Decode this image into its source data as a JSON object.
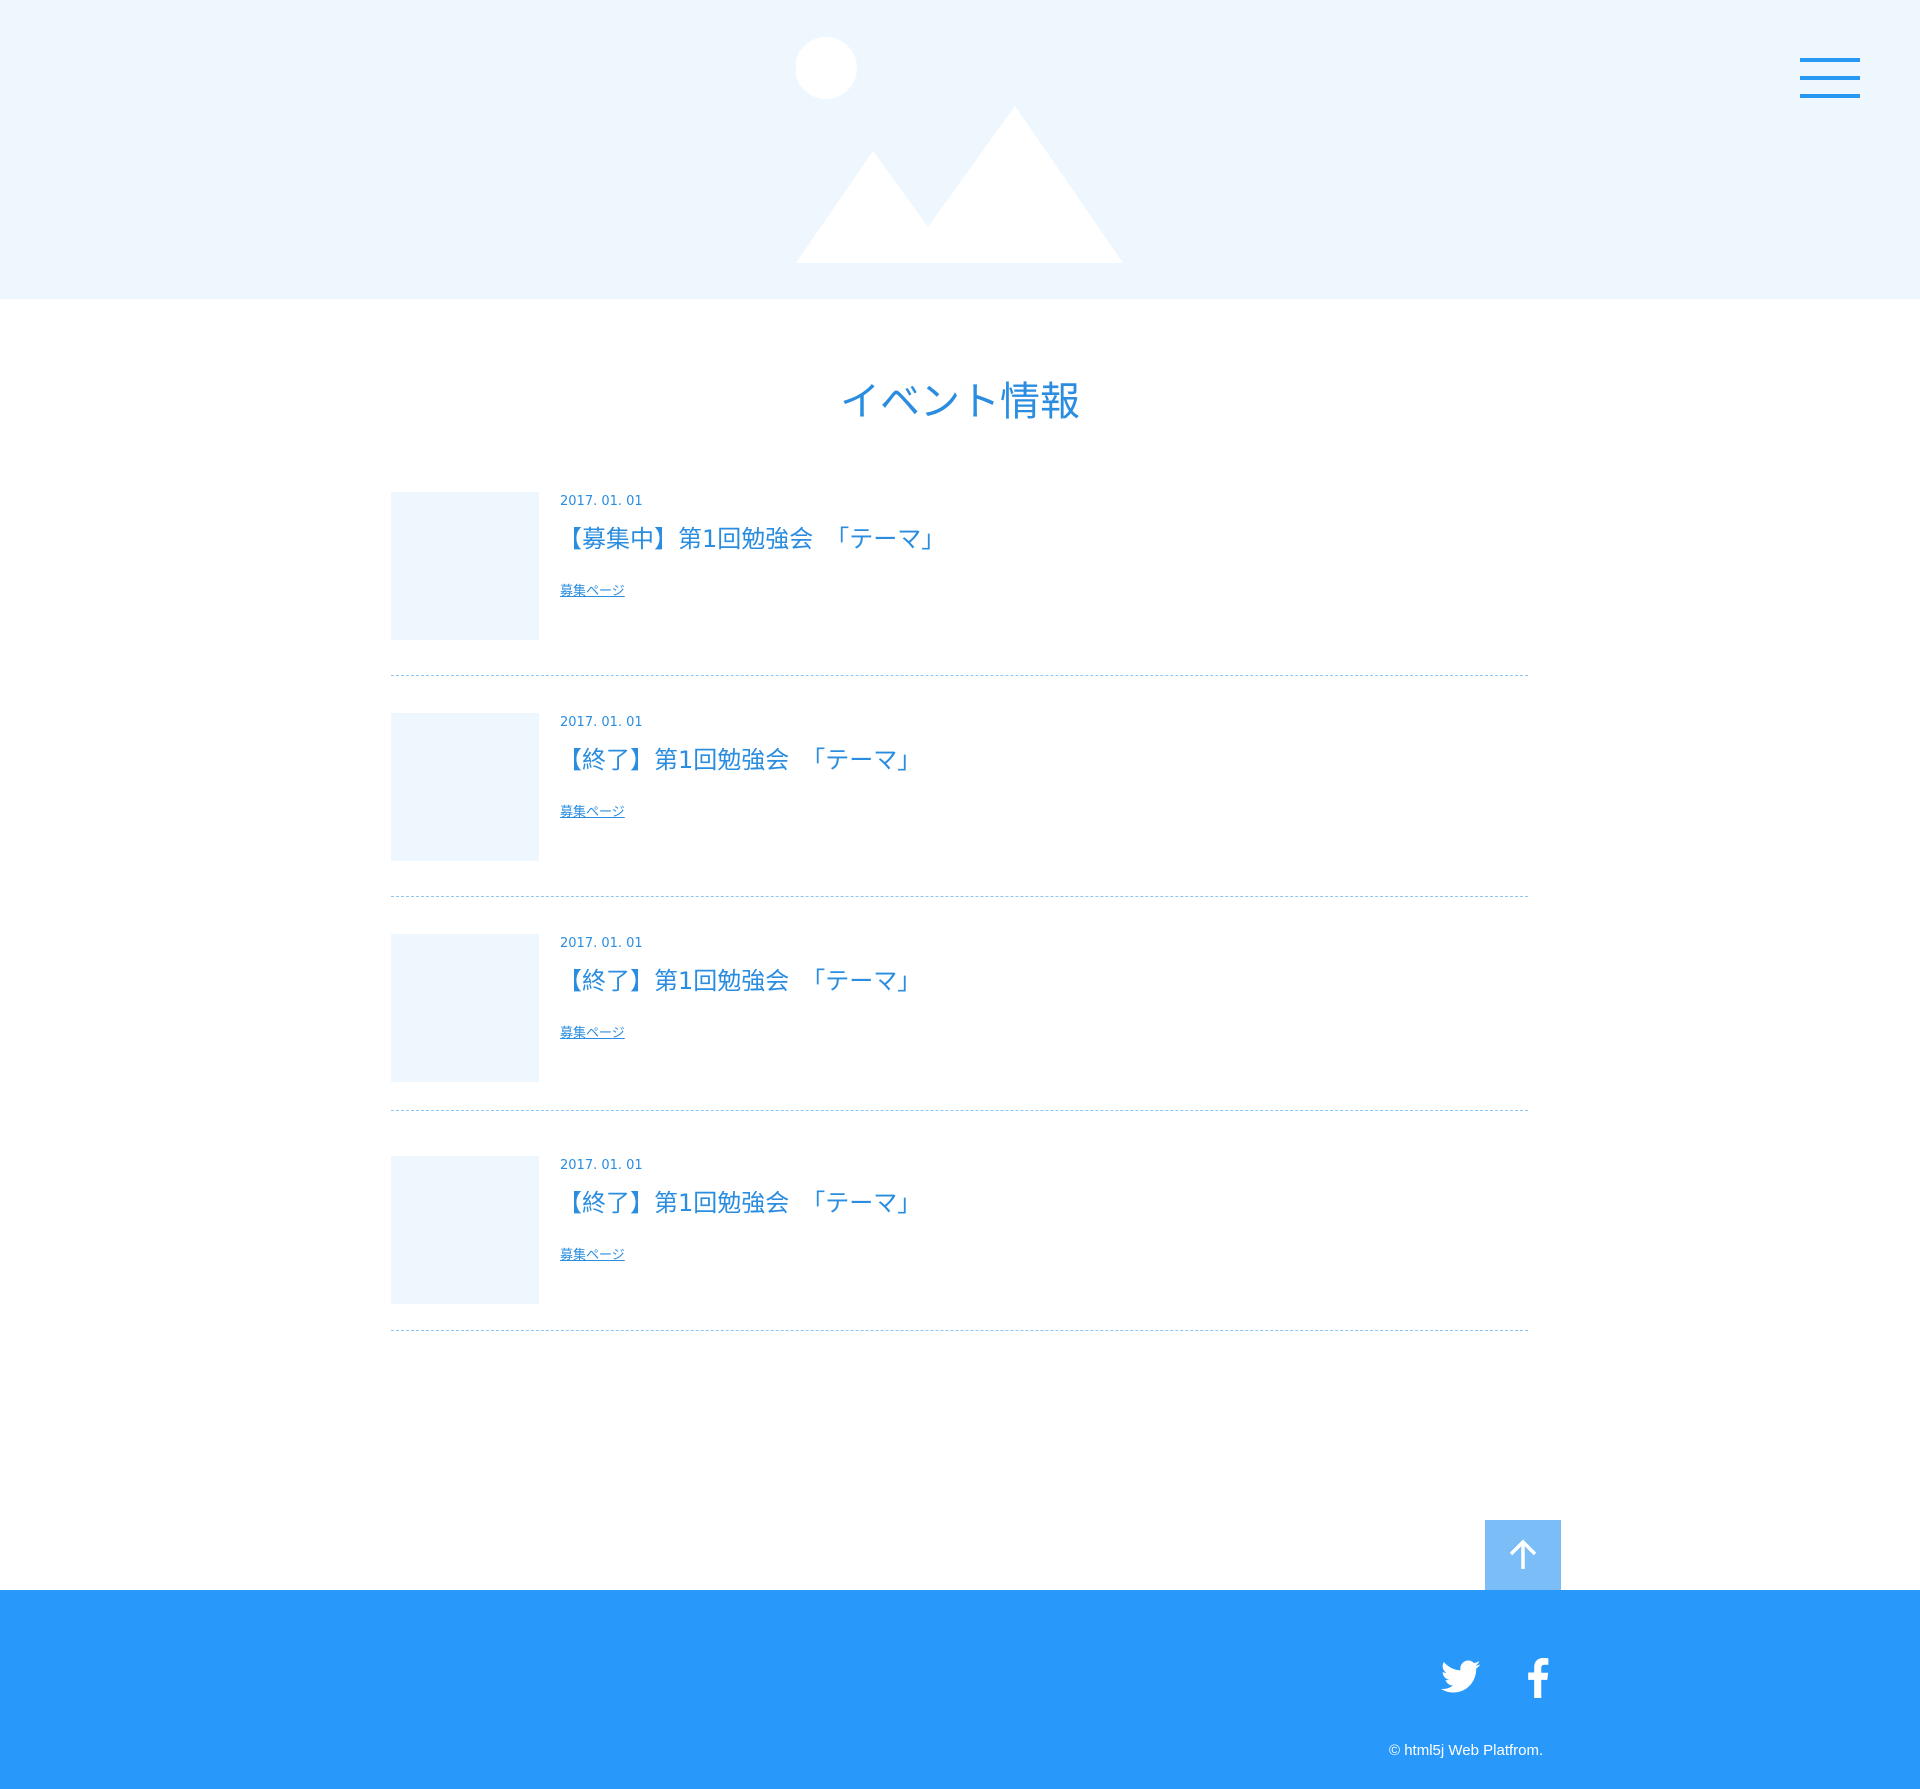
{
  "header": {
    "hero_image": "mountain-image-placeholder",
    "menu_icon": "hamburger-menu-icon",
    "accent_color": "#2898f5"
  },
  "main": {
    "title": "イベント情報",
    "events": [
      {
        "date": "2017. 01. 01",
        "title": "【募集中】第1回勉強会　「テーマ」",
        "link_label": "募集ページ"
      },
      {
        "date": "2017. 01. 01",
        "title": "【終了】第1回勉強会　「テーマ」",
        "link_label": "募集ページ"
      },
      {
        "date": "2017. 01. 01",
        "title": "【終了】第1回勉強会　「テーマ」",
        "link_label": "募集ページ"
      },
      {
        "date": "2017. 01. 01",
        "title": "【終了】第1回勉強会　「テーマ」",
        "link_label": "募集ページ"
      }
    ]
  },
  "back_to_top": {
    "icon": "arrow-up-icon"
  },
  "footer": {
    "social": [
      "twitter-icon",
      "facebook-icon"
    ],
    "copyright": "© html5j Web Platfrom.",
    "background_color": "#2898fa"
  }
}
